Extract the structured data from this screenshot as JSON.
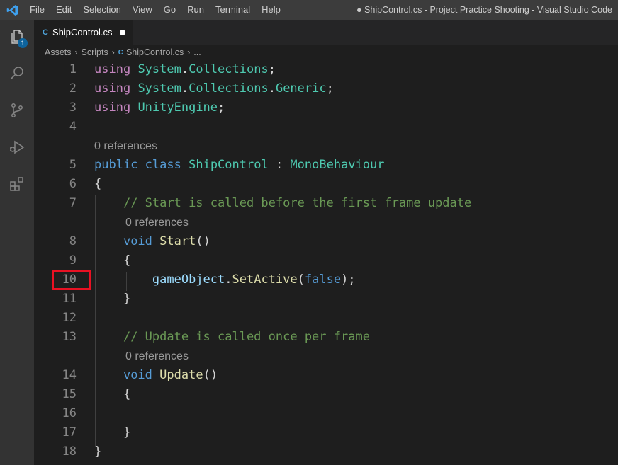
{
  "menu": [
    "File",
    "Edit",
    "Selection",
    "View",
    "Go",
    "Run",
    "Terminal",
    "Help"
  ],
  "window_title": "● ShipControl.cs - Project Practice Shooting - Visual Studio Code",
  "activity_badge": "1",
  "tab": {
    "icon_text": "C",
    "label": "ShipControl.cs"
  },
  "breadcrumb": {
    "items": [
      "Assets",
      "Scripts",
      "ShipControl.cs",
      "..."
    ],
    "file_icon_text": "C"
  },
  "codelens": "0 references",
  "lines": [
    {
      "num": "1",
      "code": [
        [
          "kw-using",
          "using"
        ],
        [
          "punc",
          " "
        ],
        [
          "ns",
          "System"
        ],
        [
          "punc",
          "."
        ],
        [
          "ns",
          "Collections"
        ],
        [
          "punc",
          ";"
        ]
      ]
    },
    {
      "num": "2",
      "code": [
        [
          "kw-using",
          "using"
        ],
        [
          "punc",
          " "
        ],
        [
          "ns",
          "System"
        ],
        [
          "punc",
          "."
        ],
        [
          "ns",
          "Collections"
        ],
        [
          "punc",
          "."
        ],
        [
          "ns",
          "Generic"
        ],
        [
          "punc",
          ";"
        ]
      ]
    },
    {
      "num": "3",
      "code": [
        [
          "kw-using",
          "using"
        ],
        [
          "punc",
          " "
        ],
        [
          "cls",
          "UnityEngine"
        ],
        [
          "punc",
          ";"
        ]
      ]
    },
    {
      "num": "4",
      "code": []
    },
    {
      "num": "5",
      "code": [
        [
          "kw",
          "public"
        ],
        [
          "punc",
          " "
        ],
        [
          "kw",
          "class"
        ],
        [
          "punc",
          " "
        ],
        [
          "cls",
          "ShipControl"
        ],
        [
          "punc",
          " : "
        ],
        [
          "cls",
          "MonoBehaviour"
        ]
      ]
    },
    {
      "num": "6",
      "code": [
        [
          "punc",
          "{"
        ]
      ]
    },
    {
      "num": "7",
      "code": [
        [
          "punc",
          "    "
        ],
        [
          "comment",
          "// Start is called before the first frame update"
        ]
      ]
    },
    {
      "num": "8",
      "code": [
        [
          "punc",
          "    "
        ],
        [
          "kw",
          "void"
        ],
        [
          "punc",
          " "
        ],
        [
          "fn",
          "Start"
        ],
        [
          "punc",
          "()"
        ]
      ]
    },
    {
      "num": "9",
      "code": [
        [
          "punc",
          "    {"
        ]
      ]
    },
    {
      "num": "10",
      "code": [
        [
          "punc",
          "        "
        ],
        [
          "var",
          "gameObject"
        ],
        [
          "punc",
          "."
        ],
        [
          "fn",
          "SetActive"
        ],
        [
          "punc",
          "("
        ],
        [
          "kw",
          "false"
        ],
        [
          "punc",
          ");"
        ]
      ]
    },
    {
      "num": "11",
      "code": [
        [
          "punc",
          "    }"
        ]
      ]
    },
    {
      "num": "12",
      "code": []
    },
    {
      "num": "13",
      "code": [
        [
          "punc",
          "    "
        ],
        [
          "comment",
          "// Update is called once per frame"
        ]
      ]
    },
    {
      "num": "14",
      "code": [
        [
          "punc",
          "    "
        ],
        [
          "kw",
          "void"
        ],
        [
          "punc",
          " "
        ],
        [
          "fn",
          "Update"
        ],
        [
          "punc",
          "()"
        ]
      ]
    },
    {
      "num": "15",
      "code": [
        [
          "punc",
          "    {"
        ]
      ]
    },
    {
      "num": "16",
      "code": []
    },
    {
      "num": "17",
      "code": [
        [
          "punc",
          "    }"
        ]
      ]
    },
    {
      "num": "18",
      "code": [
        [
          "punc",
          "}"
        ]
      ]
    }
  ],
  "colors": {
    "keyword": "#569cd6",
    "using_keyword": "#c586c0",
    "type": "#4ec9b0",
    "function": "#dcdcaa",
    "comment": "#6a9955",
    "variable": "#9cdcfe",
    "highlight_border": "#e81123"
  }
}
